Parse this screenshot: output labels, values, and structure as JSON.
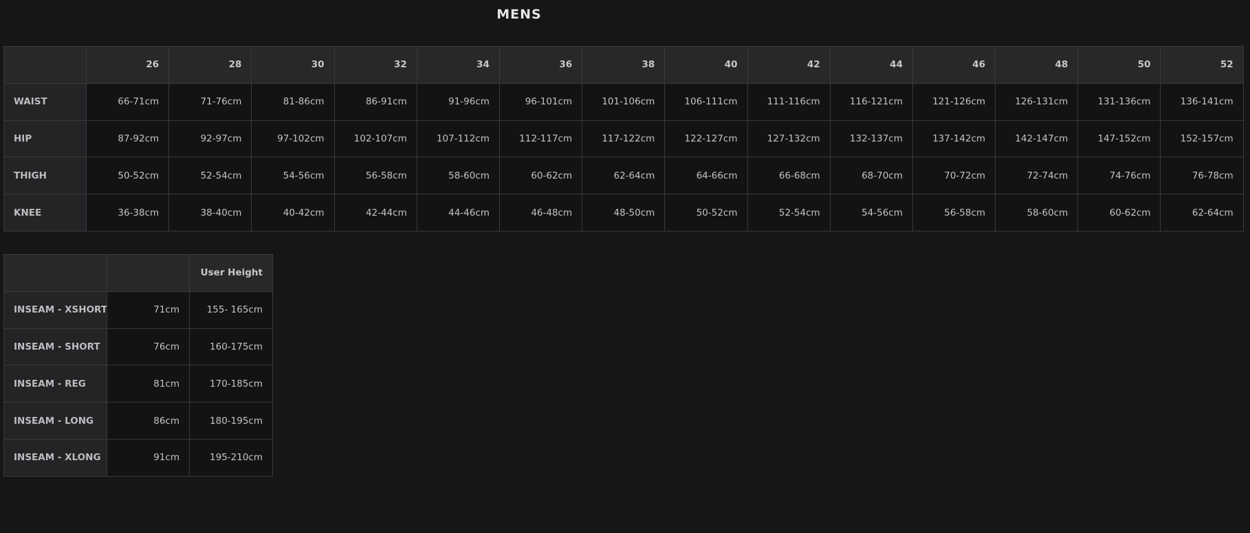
{
  "title": "MENS",
  "size_table": {
    "corner": "",
    "sizes": [
      "26",
      "28",
      "30",
      "32",
      "34",
      "36",
      "38",
      "40",
      "42",
      "44",
      "46",
      "48",
      "50",
      "52"
    ],
    "rows": [
      {
        "label": "WAIST",
        "values": [
          "66-71cm",
          "71-76cm",
          "81-86cm",
          "86-91cm",
          "91-96cm",
          "96-101cm",
          "101-106cm",
          "106-111cm",
          "111-116cm",
          "116-121cm",
          "121-126cm",
          "126-131cm",
          "131-136cm",
          "136-141cm"
        ]
      },
      {
        "label": "HIP",
        "values": [
          "87-92cm",
          "92-97cm",
          "97-102cm",
          "102-107cm",
          "107-112cm",
          "112-117cm",
          "117-122cm",
          "122-127cm",
          "127-132cm",
          "132-137cm",
          "137-142cm",
          "142-147cm",
          "147-152cm",
          "152-157cm"
        ]
      },
      {
        "label": "THIGH",
        "values": [
          "50-52cm",
          "52-54cm",
          "54-56cm",
          "56-58cm",
          "58-60cm",
          "60-62cm",
          "62-64cm",
          "64-66cm",
          "66-68cm",
          "68-70cm",
          "70-72cm",
          "72-74cm",
          "74-76cm",
          "76-78cm"
        ]
      },
      {
        "label": "KNEE",
        "values": [
          "36-38cm",
          "38-40cm",
          "40-42cm",
          "42-44cm",
          "44-46cm",
          "46-48cm",
          "48-50cm",
          "50-52cm",
          "52-54cm",
          "54-56cm",
          "56-58cm",
          "58-60cm",
          "60-62cm",
          "62-64cm"
        ]
      }
    ]
  },
  "inseam_table": {
    "headers": [
      "",
      "",
      "User Height"
    ],
    "rows": [
      {
        "label": "INSEAM - XSHORT",
        "inseam": "71cm",
        "height": "155- 165cm"
      },
      {
        "label": "INSEAM - SHORT",
        "inseam": "76cm",
        "height": "160-175cm"
      },
      {
        "label": "INSEAM - REG",
        "inseam": "81cm",
        "height": "170-185cm"
      },
      {
        "label": "INSEAM - LONG",
        "inseam": "86cm",
        "height": "180-195cm"
      },
      {
        "label": "INSEAM - XLONG",
        "inseam": "91cm",
        "height": "195-210cm"
      }
    ]
  },
  "colors": {
    "background": "#161618",
    "header_cell": "#28282b",
    "label_cell": "#242427",
    "data_cell": "#131315",
    "border": "#3a3a3d",
    "text": "#c4c4c6"
  }
}
